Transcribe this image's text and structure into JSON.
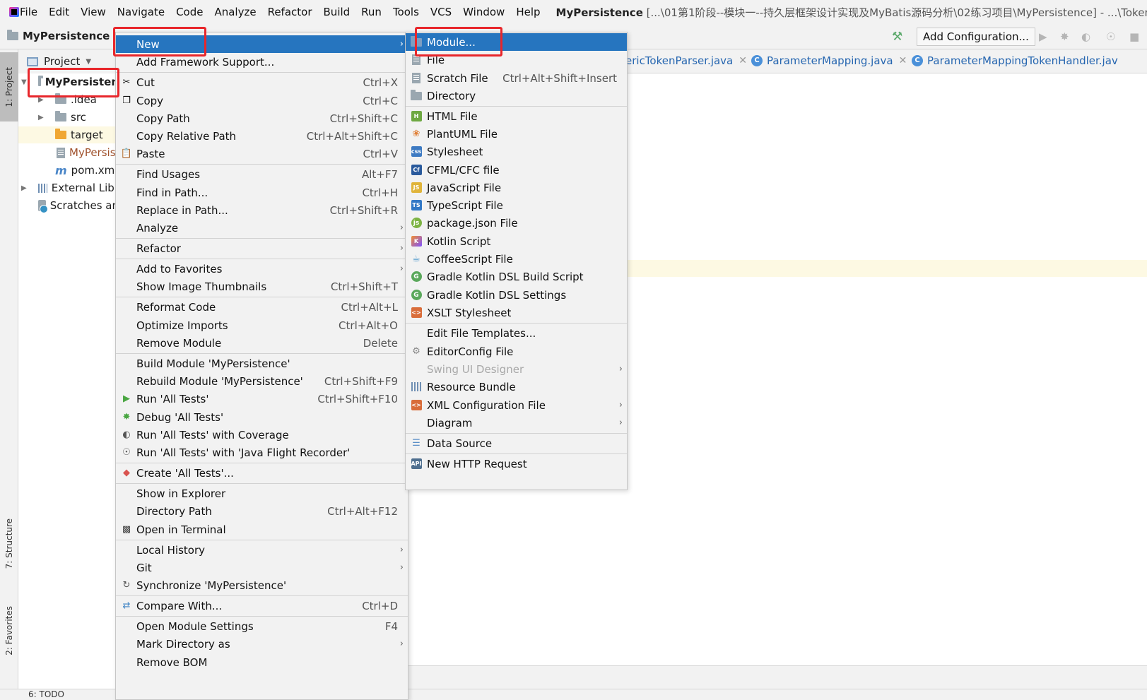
{
  "menubar": {
    "items": [
      "File",
      "Edit",
      "View",
      "Navigate",
      "Code",
      "Analyze",
      "Refactor",
      "Build",
      "Run",
      "Tools",
      "VCS",
      "Window",
      "Help"
    ],
    "title_project": "MyPersistence",
    "title_path": " [...\\01第1阶段--模块一--持久层框架设计实现及MyBatis源码分析\\02练习项目\\MyPersistence] - ...\\TokenH"
  },
  "navbar": {
    "project": "MyPersistence",
    "add_config": "Add Configuration..."
  },
  "left_strip": {
    "project_tab": "1: Project",
    "structure_tab": "7: Structure",
    "favorites_tab": "2: Favorites"
  },
  "project_panel": {
    "header": "Project",
    "tree": [
      {
        "label": "MyPersisten"
      },
      {
        "label": ".idea"
      },
      {
        "label": "src"
      },
      {
        "label": "target"
      },
      {
        "label": "MyPersis"
      },
      {
        "label": "pom.xml"
      },
      {
        "label": "External Libr"
      },
      {
        "label": "Scratches an"
      }
    ]
  },
  "editor_tabs": [
    {
      "label": "ericTokenParser.java"
    },
    {
      "label": "ParameterMapping.java"
    },
    {
      "label": "ParameterMappingTokenHandler.jav"
    }
  ],
  "context_menu": {
    "items": [
      {
        "label": "New",
        "shortcut": ""
      },
      {
        "label": "Add Framework Support...",
        "shortcut": ""
      },
      {
        "label": "Cut",
        "shortcut": "Ctrl+X"
      },
      {
        "label": "Copy",
        "shortcut": "Ctrl+C"
      },
      {
        "label": "Copy Path",
        "shortcut": "Ctrl+Shift+C"
      },
      {
        "label": "Copy Relative Path",
        "shortcut": "Ctrl+Alt+Shift+C"
      },
      {
        "label": "Paste",
        "shortcut": "Ctrl+V"
      },
      {
        "label": "Find Usages",
        "shortcut": "Alt+F7"
      },
      {
        "label": "Find in Path...",
        "shortcut": "Ctrl+H"
      },
      {
        "label": "Replace in Path...",
        "shortcut": "Ctrl+Shift+R"
      },
      {
        "label": "Analyze",
        "shortcut": ""
      },
      {
        "label": "Refactor",
        "shortcut": ""
      },
      {
        "label": "Add to Favorites",
        "shortcut": ""
      },
      {
        "label": "Show Image Thumbnails",
        "shortcut": "Ctrl+Shift+T"
      },
      {
        "label": "Reformat Code",
        "shortcut": "Ctrl+Alt+L"
      },
      {
        "label": "Optimize Imports",
        "shortcut": "Ctrl+Alt+O"
      },
      {
        "label": "Remove Module",
        "shortcut": "Delete"
      },
      {
        "label": "Build Module 'MyPersistence'",
        "shortcut": ""
      },
      {
        "label": "Rebuild Module 'MyPersistence'",
        "shortcut": "Ctrl+Shift+F9"
      },
      {
        "label": "Run 'All Tests'",
        "shortcut": "Ctrl+Shift+F10"
      },
      {
        "label": "Debug 'All Tests'",
        "shortcut": ""
      },
      {
        "label": "Run 'All Tests' with Coverage",
        "shortcut": ""
      },
      {
        "label": "Run 'All Tests' with 'Java Flight Recorder'",
        "shortcut": ""
      },
      {
        "label": "Create 'All Tests'...",
        "shortcut": ""
      },
      {
        "label": "Show in Explorer",
        "shortcut": ""
      },
      {
        "label": "Directory Path",
        "shortcut": "Ctrl+Alt+F12"
      },
      {
        "label": "Open in Terminal",
        "shortcut": ""
      },
      {
        "label": "Local History",
        "shortcut": ""
      },
      {
        "label": "Git",
        "shortcut": ""
      },
      {
        "label": "Synchronize 'MyPersistence'",
        "shortcut": ""
      },
      {
        "label": "Compare With...",
        "shortcut": "Ctrl+D"
      },
      {
        "label": "Open Module Settings",
        "shortcut": "F4"
      },
      {
        "label": "Mark Directory as",
        "shortcut": ""
      },
      {
        "label": "Remove BOM",
        "shortcut": ""
      }
    ]
  },
  "new_submenu": {
    "items": [
      {
        "label": "Module...",
        "shortcut": ""
      },
      {
        "label": "File",
        "shortcut": ""
      },
      {
        "label": "Scratch File",
        "shortcut": "Ctrl+Alt+Shift+Insert"
      },
      {
        "label": "Directory",
        "shortcut": ""
      },
      {
        "label": "HTML File",
        "shortcut": ""
      },
      {
        "label": "PlantUML File",
        "shortcut": ""
      },
      {
        "label": "Stylesheet",
        "shortcut": ""
      },
      {
        "label": "CFML/CFC file",
        "shortcut": ""
      },
      {
        "label": "JavaScript File",
        "shortcut": ""
      },
      {
        "label": "TypeScript File",
        "shortcut": ""
      },
      {
        "label": "package.json File",
        "shortcut": ""
      },
      {
        "label": "Kotlin Script",
        "shortcut": ""
      },
      {
        "label": "CoffeeScript File",
        "shortcut": ""
      },
      {
        "label": "Gradle Kotlin DSL Build Script",
        "shortcut": ""
      },
      {
        "label": "Gradle Kotlin DSL Settings",
        "shortcut": ""
      },
      {
        "label": "XSLT Stylesheet",
        "shortcut": ""
      },
      {
        "label": "Edit File Templates...",
        "shortcut": ""
      },
      {
        "label": "EditorConfig File",
        "shortcut": ""
      },
      {
        "label": "Swing UI Designer",
        "shortcut": ""
      },
      {
        "label": "Resource Bundle",
        "shortcut": ""
      },
      {
        "label": "XML Configuration File",
        "shortcut": ""
      },
      {
        "label": "Diagram",
        "shortcut": ""
      },
      {
        "label": "Data Source",
        "shortcut": ""
      },
      {
        "label": "New HTTP Request",
        "shortcut": ""
      }
    ]
  },
  "bottom_bar": {
    "todo": "6: TODO"
  },
  "colors": {
    "menu_highlight": "#2675bf",
    "annotation_red": "#e8262b",
    "panel_bg": "#f2f2f2",
    "caret_row": "#fdf9e3"
  }
}
